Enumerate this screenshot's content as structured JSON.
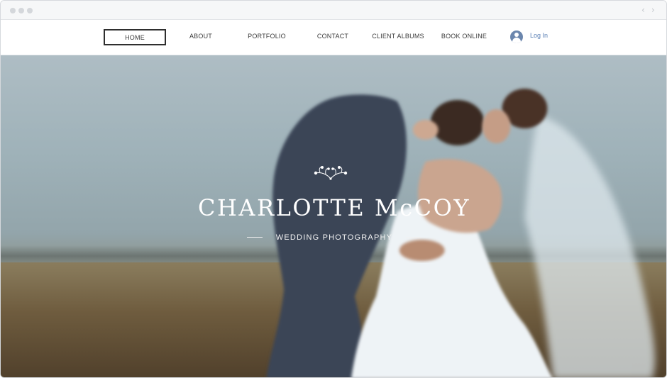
{
  "browser": {
    "back_icon": "chevron-left-icon",
    "forward_icon": "chevron-right-icon",
    "back_glyph": "‹",
    "forward_glyph": "›"
  },
  "nav": {
    "items": [
      {
        "label": "HOME",
        "active": true
      },
      {
        "label": "ABOUT"
      },
      {
        "label": "PORTFOLIO"
      },
      {
        "label": "CONTACT"
      },
      {
        "label": "CLIENT ALBUMS"
      },
      {
        "label": "BOOK ONLINE"
      }
    ],
    "login": {
      "label": "Log In",
      "icon": "user-avatar-icon"
    }
  },
  "hero": {
    "title": "CHARLOTTE McCOY",
    "tagline": "WEDDING PHOTOGRAPHY",
    "ornament_icon": "floral-ornament-icon"
  },
  "colors": {
    "nav_text": "#3b3b3b",
    "login_text": "#5a7fb5",
    "avatar": "#6b86ad",
    "hero_text": "#ffffff"
  }
}
